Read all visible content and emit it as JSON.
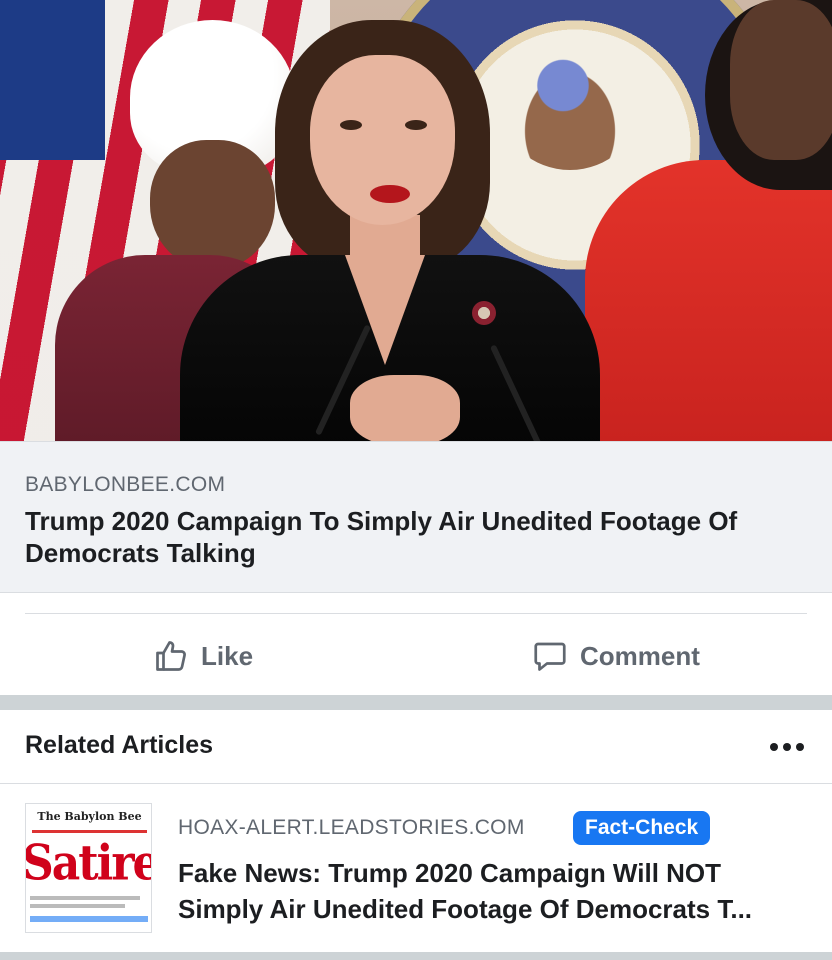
{
  "post": {
    "image_description_icon": "photo",
    "link_preview": {
      "domain": "BABYLONBEE.COM",
      "title": "Trump 2020 Campaign To Simply Air Unedited Footage Of Democrats Talking"
    },
    "actions": {
      "like_label": "Like",
      "comment_label": "Comment"
    }
  },
  "related": {
    "header": "Related Articles",
    "items": [
      {
        "thumbnail_brand": "The Babylon Bee",
        "thumbnail_word": "Satire",
        "domain": "HOAX-ALERT.LEADSTORIES.COM",
        "badge": "Fact-Check",
        "title_line1": "Fake News: Trump 2020 Campaign Will NOT",
        "title_line2": "Simply Air Unedited Footage Of Democrats T..."
      }
    ]
  },
  "colors": {
    "accent": "#1877f2",
    "text_primary": "#1c1e21",
    "text_secondary": "#606770",
    "preview_bg": "#f0f2f5",
    "separator": "#cdd3d6"
  }
}
